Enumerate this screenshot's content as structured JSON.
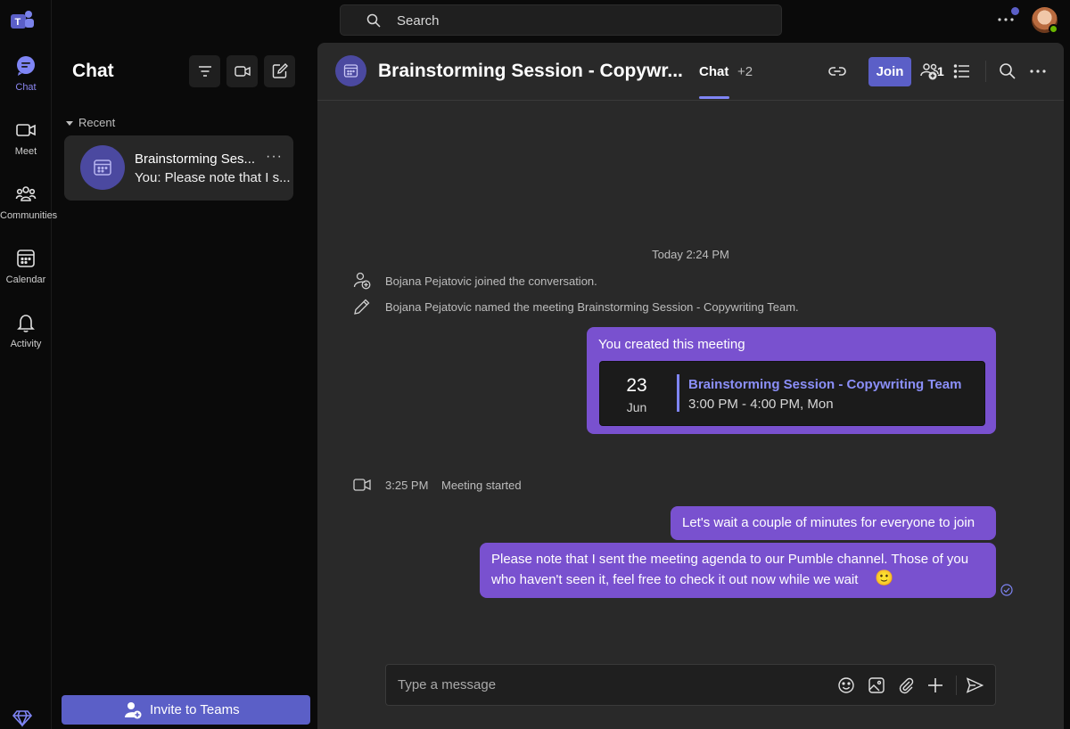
{
  "app": {
    "name": "Microsoft Teams",
    "accent": "#5b5fc7",
    "bubble_color": "#7951cf"
  },
  "rail": {
    "items": [
      {
        "id": "chat",
        "label": "Chat",
        "icon": "chat-icon",
        "active": true
      },
      {
        "id": "meet",
        "label": "Meet",
        "icon": "video-camera-icon"
      },
      {
        "id": "communities",
        "label": "Communities",
        "icon": "communities-icon"
      },
      {
        "id": "calendar",
        "label": "Calendar",
        "icon": "calendar-icon"
      },
      {
        "id": "activity",
        "label": "Activity",
        "icon": "bell-icon"
      }
    ]
  },
  "topbar": {
    "search_placeholder": "Search"
  },
  "chat_list": {
    "title": "Chat",
    "section": "Recent",
    "conversation": {
      "name": "Brainstorming Ses...",
      "more": "···",
      "preview": "You: Please note that I s..."
    },
    "invite_label": "Invite to Teams"
  },
  "conversation": {
    "title": "Brainstorming Session - Copywr...",
    "active_tab": "Chat",
    "more_tabs": "+2",
    "join_label": "Join",
    "participants_count": "1",
    "timestamp": "Today 2:24 PM",
    "system_messages": [
      "Bojana Pejatovic joined the conversation.",
      "Bojana Pejatovic named the meeting Brainstorming Session - Copywriting Team."
    ],
    "meeting_bubble": {
      "heading": "You created this meeting",
      "day": "23",
      "month": "Jun",
      "title": "Brainstorming Session - Copywriting Team",
      "time": "3:00 PM - 4:00 PM, Mon"
    },
    "meeting_started": {
      "time": "3:25 PM",
      "text": "Meeting started"
    },
    "messages": [
      "Let's wait a couple of minutes for everyone to join",
      "Please note that I sent the meeting agenda to our Pumble channel. Those of you",
      "who haven't seen it, feel free to check it out now while we wait"
    ],
    "message_emoji": "🙂",
    "composer_placeholder": "Type a message"
  }
}
